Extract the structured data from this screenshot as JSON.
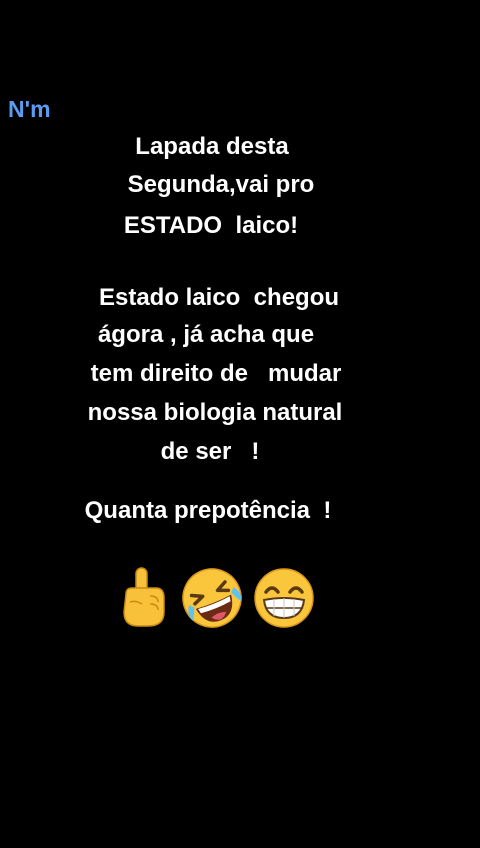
{
  "post": {
    "author": "N'm",
    "lines": [
      "Lapada desta",
      "Segunda,vai pro",
      "ESTADO  laico!",
      "Estado laico  chegou",
      "ágora , já acha que",
      "tem direito de   mudar",
      "nossa biologia natural",
      "de ser   !",
      "Quanta prepotência  !"
    ],
    "emojis": [
      "pointing-up-icon",
      "rolling-laughing-face-icon",
      "grinning-face-icon"
    ],
    "background": "#000000",
    "author_color": "#5b9bf0"
  }
}
